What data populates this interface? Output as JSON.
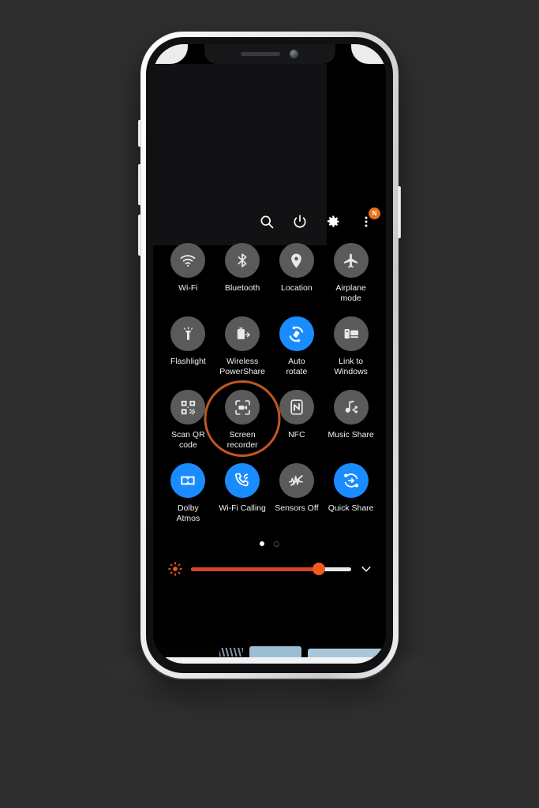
{
  "device": {
    "type": "smartphone",
    "frame_color": "#ededed",
    "screen_background": "#000000"
  },
  "panel": {
    "title": "Quick settings panel",
    "header_actions": [
      {
        "name": "search",
        "icon": "search-icon",
        "label": "Search"
      },
      {
        "name": "power",
        "icon": "power-icon",
        "label": "Power off"
      },
      {
        "name": "settings",
        "icon": "gear-icon",
        "label": "Settings"
      },
      {
        "name": "more",
        "icon": "more-vert-icon",
        "label": "More options",
        "badge": "N"
      }
    ],
    "toggles": [
      {
        "label": "Wi-Fi",
        "icon": "wifi-icon",
        "state": "off"
      },
      {
        "label": "Bluetooth",
        "icon": "bluetooth-icon",
        "state": "off"
      },
      {
        "label": "Location",
        "icon": "location-pin-icon",
        "state": "off"
      },
      {
        "label": "Airplane\nmode",
        "icon": "airplane-icon",
        "state": "off"
      },
      {
        "label": "Flashlight",
        "icon": "flashlight-icon",
        "state": "off"
      },
      {
        "label": "Wireless\nPowerShare",
        "icon": "wireless-powershare-icon",
        "state": "off"
      },
      {
        "label": "Auto\nrotate",
        "icon": "auto-rotate-icon",
        "state": "on"
      },
      {
        "label": "Link to\nWindows",
        "icon": "link-to-windows-icon",
        "state": "off"
      },
      {
        "label": "Scan QR\ncode",
        "icon": "qr-code-icon",
        "state": "off"
      },
      {
        "label": "Screen\nrecorder",
        "icon": "screen-recorder-icon",
        "state": "off",
        "highlighted": true
      },
      {
        "label": "NFC",
        "icon": "nfc-icon",
        "state": "off"
      },
      {
        "label": "Music Share",
        "icon": "music-share-icon",
        "state": "off"
      },
      {
        "label": "Dolby\nAtmos",
        "icon": "dolby-atmos-icon",
        "state": "on"
      },
      {
        "label": "Wi-Fi Calling",
        "icon": "wifi-calling-icon",
        "state": "on"
      },
      {
        "label": "Sensors Off",
        "icon": "sensors-off-icon",
        "state": "off"
      },
      {
        "label": "Quick Share",
        "icon": "quick-share-icon",
        "state": "on"
      }
    ],
    "pagination": {
      "pages": 2,
      "active_page": 1
    },
    "brightness": {
      "icon": "brightness-icon",
      "value_percent": 80,
      "expand_icon": "chevron-down-icon"
    }
  },
  "annotation": {
    "target_label": "Screen recorder",
    "shape": "circle",
    "color": "#c2571f"
  },
  "colors": {
    "page_background": "#2e2e2e",
    "toggle_off": "#5a5a5a",
    "toggle_on": "#1a8cff",
    "badge": "#e8701a",
    "slider_fill": "#d8442a",
    "slider_knob": "#ef5a23",
    "slider_track": "#e9e9e9"
  }
}
